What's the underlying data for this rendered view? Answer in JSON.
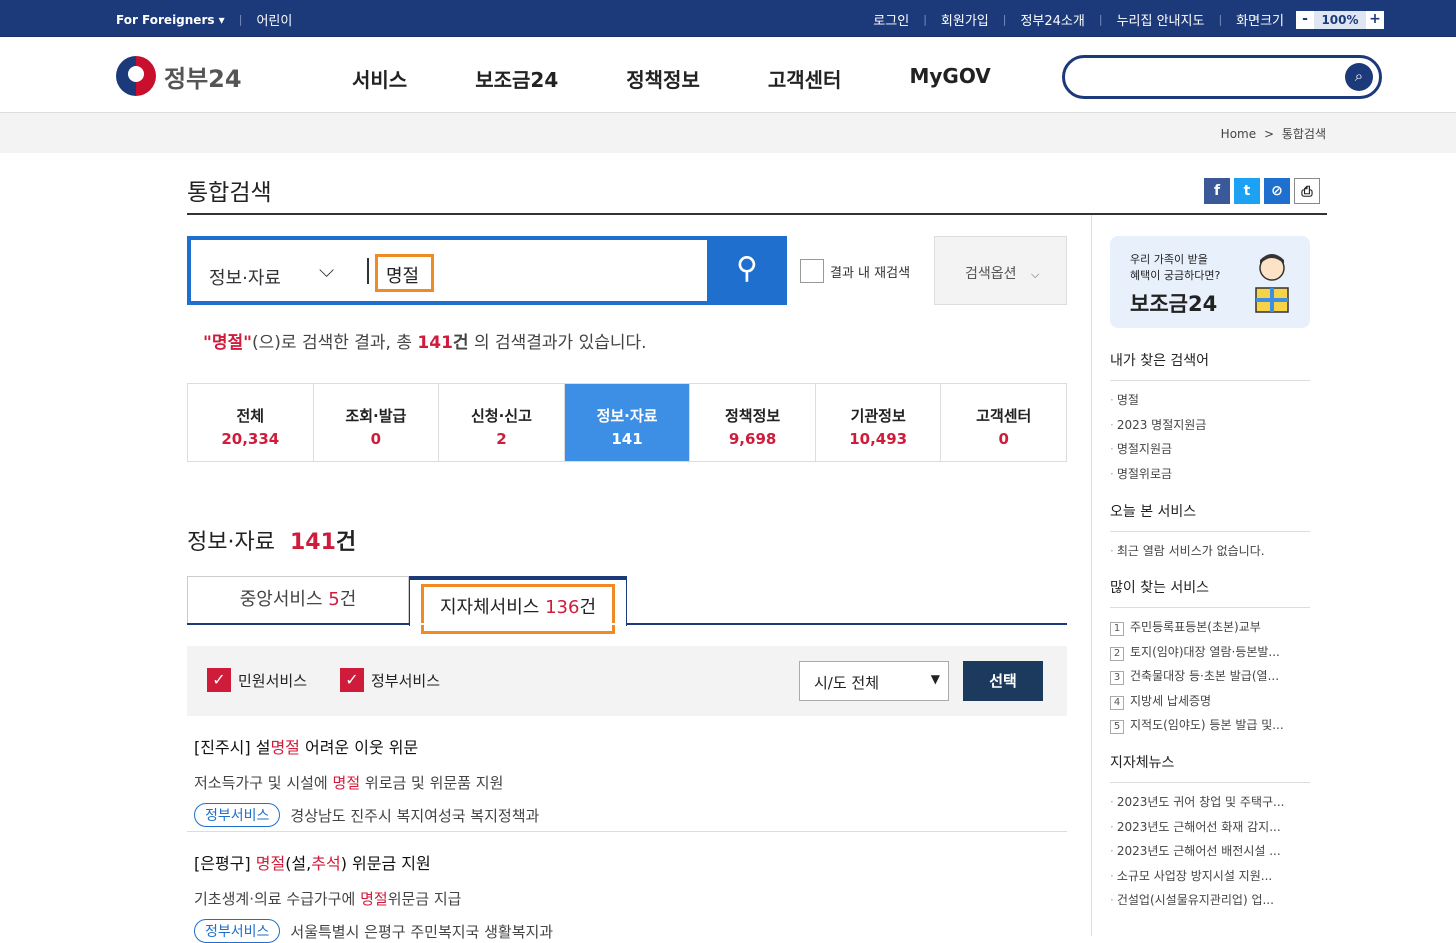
{
  "topbar": {
    "foreigners": "For Foreigners ▾",
    "kids": "어린이",
    "links": [
      "로그인",
      "회원가입",
      "정부24소개",
      "누리집 안내지도",
      "화면크기"
    ],
    "zoom_minus": "-",
    "zoom_value": "100%",
    "zoom_plus": "+"
  },
  "header": {
    "logo_text": "정부24",
    "nav": [
      "서비스",
      "보조금24",
      "정책정보",
      "고객센터",
      "MyGOV"
    ],
    "search_placeholder": ""
  },
  "breadcrumb": {
    "home": "Home",
    "sep": ">",
    "current": "통합검색"
  },
  "page_title": "통합검색",
  "search": {
    "category": "정보·자료",
    "query": "명절",
    "recheck_label": "결과 내 재검색",
    "options_label": "검색옵션"
  },
  "result_summary": {
    "quote_open": "\"",
    "query": "명절",
    "quote_close": "\"",
    "text1": "(으)로 검색한 결과, 총 ",
    "count": "141",
    "unit": "건",
    "text2": " 의 검색결과가 있습니다."
  },
  "tabs": [
    {
      "label": "전체",
      "count": "20,334"
    },
    {
      "label": "조회·발급",
      "count": "0"
    },
    {
      "label": "신청·신고",
      "count": "2"
    },
    {
      "label": "정보·자료",
      "count": "141"
    },
    {
      "label": "정책정보",
      "count": "9,698"
    },
    {
      "label": "기관정보",
      "count": "10,493"
    },
    {
      "label": "고객센터",
      "count": "0"
    }
  ],
  "section": {
    "title": "정보·자료",
    "count": "141",
    "unit": "건"
  },
  "subtabs": [
    {
      "label": "중앙서비스",
      "count": "5",
      "unit": "건"
    },
    {
      "label": "지자체서비스",
      "count": "136",
      "unit": "건"
    }
  ],
  "filter": {
    "check1": "민원서비스",
    "check2": "정부서비스",
    "region": "시/도 전체",
    "apply": "선택"
  },
  "results": [
    {
      "title_pre": "[진주시] 설",
      "title_hi": "명절",
      "title_post": " 어려운 이웃 위문",
      "desc_pre": "저소득가구 및 시설에 ",
      "desc_hi": "명절",
      "desc_post": " 위로금 및 위문품 지원",
      "badge": "정부서비스",
      "org": "경상남도 진주시 복지여성국 복지정책과"
    },
    {
      "title_pre": "[은평구] ",
      "title_hi": "명절",
      "title_mid": "(설,",
      "title_hi2": "추석",
      "title_post": ") 위문금 지원",
      "desc_pre": "기초생계·의료 수급가구에 ",
      "desc_hi": "명절",
      "desc_post": "위문금 지급",
      "badge": "정부서비스",
      "org": "서울특별시 은평구 주민복지국 생활복지과"
    }
  ],
  "sidebar": {
    "banner_sub1": "우리 가족이 받을",
    "banner_sub2": "혜택이 궁금하다면?",
    "banner_title": "보조금24",
    "recent_title": "내가 찾은 검색어",
    "recent": [
      "명절",
      "2023 명절지원금",
      "명절지원금",
      "명절위로금"
    ],
    "today_title": "오늘 본 서비스",
    "today": [
      "최근 열람 서비스가 없습니다."
    ],
    "popular_title": "많이 찾는 서비스",
    "popular": [
      "주민등록표등본(초본)교부",
      "토지(임야)대장 열람·등본발...",
      "건축물대장 등·초본 발급(열...",
      "지방세 납세증명",
      "지적도(임야도) 등본 발급 및..."
    ],
    "news_title": "지자체뉴스",
    "news": [
      "2023년도 귀어 창업 및 주택구...",
      "2023년도 근해어선 화재 감지...",
      "2023년도 근해어선 배전시설 ...",
      "소규모 사업장 방지시설 지원...",
      "건설업(시설물유지관리업) 업..."
    ]
  },
  "colors": {
    "navy": "#1c3a7a",
    "blue": "#1f6fce",
    "red": "#d01c3b",
    "highlight": "#f08a24"
  }
}
